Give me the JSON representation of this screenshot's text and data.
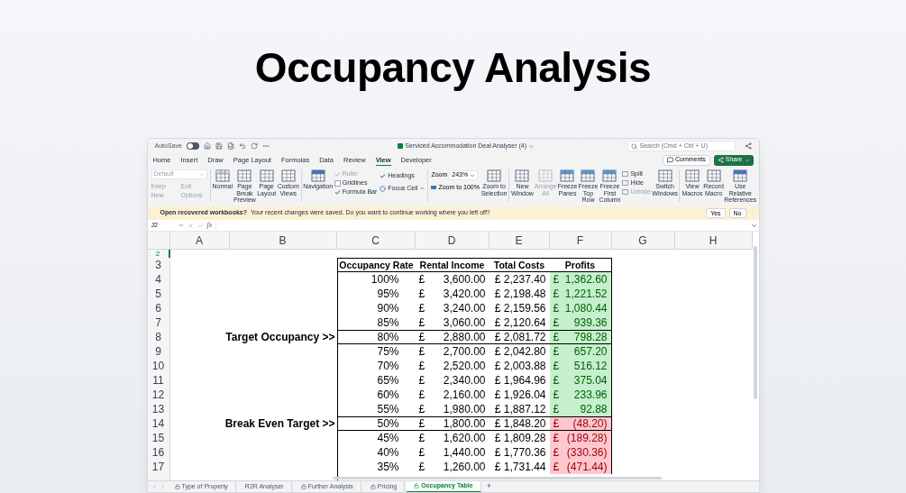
{
  "page_title": "Occupancy Analysis",
  "window": {
    "autosave_label": "AutoSave",
    "autosave_on": false,
    "title": "Serviced Accommodation Deal Analyser (4)",
    "search_placeholder": "Search (Cmd + Ctrl + U)"
  },
  "menu_tabs": [
    {
      "label": "Home",
      "selected": false
    },
    {
      "label": "Insert",
      "selected": false
    },
    {
      "label": "Draw",
      "selected": false
    },
    {
      "label": "Page Layout",
      "selected": false
    },
    {
      "label": "Formulas",
      "selected": false
    },
    {
      "label": "Data",
      "selected": false
    },
    {
      "label": "Review",
      "selected": false
    },
    {
      "label": "View",
      "selected": true
    },
    {
      "label": "Developer",
      "selected": false
    }
  ],
  "comments_button": "Comments",
  "share_button": "Share",
  "ribbon": {
    "style_dropdown": "Default",
    "sheet_view_buttons": [
      {
        "label": "Keep",
        "disabled": true
      },
      {
        "label": "Exit",
        "disabled": true
      },
      {
        "label": "New",
        "disabled": true
      },
      {
        "label": "Options",
        "disabled": true
      }
    ],
    "view_buttons": [
      "Normal",
      "Page Break Preview",
      "Page Layout",
      "Custom Views"
    ],
    "navigation": "Navigation",
    "show_options": [
      {
        "label": "Ruler",
        "checked": true,
        "disabled": true
      },
      {
        "label": "Gridlines",
        "checked": false,
        "disabled": false
      },
      {
        "label": "Formula Bar",
        "checked": true,
        "disabled": false
      }
    ],
    "headings": {
      "label": "Headings",
      "checked": true
    },
    "focus_cell": "Focus Cell",
    "zoom_label": "Zoom",
    "zoom_value": "243%",
    "zoom_100": "Zoom to 100%",
    "zoom_selection": "Zoom to Selection",
    "window_buttons": [
      {
        "label": "New Window",
        "disabled": false
      },
      {
        "label": "Arrange All",
        "disabled": true
      },
      {
        "label": "Freeze Panes",
        "disabled": false
      },
      {
        "label": "Freeze Top Row",
        "disabled": false
      },
      {
        "label": "Freeze First Column",
        "disabled": false
      }
    ],
    "split_items": [
      {
        "label": "Split",
        "disabled": false
      },
      {
        "label": "Hide",
        "disabled": false
      },
      {
        "label": "Unhide",
        "disabled": true
      }
    ],
    "switch_windows": "Switch Windows",
    "macro_buttons": [
      "View Macros",
      "Record Macro",
      "Use Relative References"
    ]
  },
  "message_bar": {
    "title": "Open recovered workbooks?",
    "text": "Your recent changes were saved. Do you want to continue working where you left off?",
    "buttons": [
      "Yes",
      "No"
    ]
  },
  "formula_bar": {
    "cell_ref": "J2",
    "fx": "fx"
  },
  "columns": [
    "A",
    "B",
    "C",
    "D",
    "E",
    "F",
    "G",
    "H"
  ],
  "header_row": {
    "number": "3",
    "cells": [
      "Occupancy Rate",
      "Rental Income",
      "Total Costs",
      "Profits"
    ]
  },
  "rows": [
    {
      "number": "4",
      "rate": "100%",
      "income_symbol": "£",
      "income": "3,600.00",
      "costs": "£ 2,237.40",
      "profit_symbol": "£",
      "profit": "1,362.60",
      "kind": "profit",
      "boxed": false
    },
    {
      "number": "5",
      "rate": "95%",
      "income_symbol": "£",
      "income": "3,420.00",
      "costs": "£ 2,198.48",
      "profit_symbol": "£",
      "profit": "1,221.52",
      "kind": "profit",
      "boxed": false
    },
    {
      "number": "6",
      "rate": "90%",
      "income_symbol": "£",
      "income": "3,240.00",
      "costs": "£ 2,159.56",
      "profit_symbol": "£",
      "profit": "1,080.44",
      "kind": "profit",
      "boxed": false
    },
    {
      "number": "7",
      "rate": "85%",
      "income_symbol": "£",
      "income": "3,060.00",
      "costs": "£ 2,120.64",
      "profit_symbol": "£",
      "profit": "939.36",
      "kind": "profit",
      "boxed": false
    },
    {
      "number": "8",
      "label": "Target Occupancy >>",
      "rate": "80%",
      "income_symbol": "£",
      "income": "2,880.00",
      "costs": "£ 2,081.72",
      "profit_symbol": "£",
      "profit": "798.28",
      "kind": "profit",
      "boxed": true
    },
    {
      "number": "9",
      "rate": "75%",
      "income_symbol": "£",
      "income": "2,700.00",
      "costs": "£ 2,042.80",
      "profit_symbol": "£",
      "profit": "657.20",
      "kind": "profit",
      "boxed": false
    },
    {
      "number": "10",
      "rate": "70%",
      "income_symbol": "£",
      "income": "2,520.00",
      "costs": "£ 2,003.88",
      "profit_symbol": "£",
      "profit": "516.12",
      "kind": "profit",
      "boxed": false
    },
    {
      "number": "11",
      "rate": "65%",
      "income_symbol": "£",
      "income": "2,340.00",
      "costs": "£ 1,964.96",
      "profit_symbol": "£",
      "profit": "375.04",
      "kind": "profit",
      "boxed": false
    },
    {
      "number": "12",
      "rate": "60%",
      "income_symbol": "£",
      "income": "2,160.00",
      "costs": "£ 1,926.04",
      "profit_symbol": "£",
      "profit": "233.96",
      "kind": "profit",
      "boxed": false
    },
    {
      "number": "13",
      "rate": "55%",
      "income_symbol": "£",
      "income": "1,980.00",
      "costs": "£ 1,887.12",
      "profit_symbol": "£",
      "profit": "92.88",
      "kind": "profit",
      "boxed": false
    },
    {
      "number": "14",
      "label": "Break Even Target >>",
      "rate": "50%",
      "income_symbol": "£",
      "income": "1,800.00",
      "costs": "£ 1,848.20",
      "profit_symbol": "£",
      "profit": "(48.20)",
      "kind": "loss",
      "boxed": true
    },
    {
      "number": "15",
      "rate": "45%",
      "income_symbol": "£",
      "income": "1,620.00",
      "costs": "£ 1,809.28",
      "profit_symbol": "£",
      "profit": "(189.28)",
      "kind": "loss",
      "boxed": false
    },
    {
      "number": "16",
      "rate": "40%",
      "income_symbol": "£",
      "income": "1,440.00",
      "costs": "£ 1,770.36",
      "profit_symbol": "£",
      "profit": "(330.36)",
      "kind": "loss",
      "boxed": false
    },
    {
      "number": "17",
      "rate": "35%",
      "income_symbol": "£",
      "income": "1,260.00",
      "costs": "£ 1,731.44",
      "profit_symbol": "£",
      "profit": "(471.44)",
      "kind": "loss",
      "boxed": false
    }
  ],
  "first_row_number": "2",
  "sheet_tabs": [
    {
      "label": "Type of Property",
      "locked": true,
      "selected": false
    },
    {
      "label": "R2R Analyser",
      "locked": false,
      "selected": false
    },
    {
      "label": "Further Analysis",
      "locked": true,
      "selected": false
    },
    {
      "label": "Pricing",
      "locked": true,
      "selected": false
    },
    {
      "label": "Occupancy Table",
      "locked": true,
      "selected": true
    }
  ],
  "add_sheet": "+"
}
